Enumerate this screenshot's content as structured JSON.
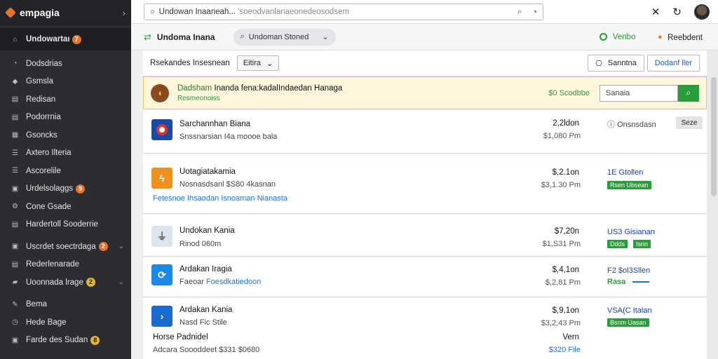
{
  "app": {
    "name": "empagia"
  },
  "sidebar": {
    "items": [
      {
        "label": "Undowartan",
        "icon": "home-icon",
        "badge": "7",
        "badge_color": "orange",
        "active": true
      },
      {
        "label": "Dodsdrias",
        "icon": "chart-icon"
      },
      {
        "label": "Gsmsla",
        "icon": "pin-icon"
      },
      {
        "label": "Redisan",
        "icon": "doc-icon"
      },
      {
        "label": "Podorrnia",
        "icon": "doc-icon"
      },
      {
        "label": "Gsoncks",
        "icon": "grid-icon"
      },
      {
        "label": "Axtero Ilteria",
        "icon": "list-icon"
      },
      {
        "label": "Ascorelile",
        "icon": "list-icon"
      },
      {
        "label": "Urdelsolaggs",
        "icon": "box-icon",
        "badge": "9",
        "badge_color": "orange"
      },
      {
        "label": "Cone Gsade",
        "icon": "gear-icon"
      },
      {
        "label": "Hardertoll Sooderrie",
        "icon": "doc-icon"
      },
      {
        "label": "Uscrdet soectrdaga",
        "icon": "box-icon",
        "badge": "2",
        "badge_color": "orange",
        "caret": true
      },
      {
        "label": "Rederlenarade",
        "icon": "doc-icon"
      },
      {
        "label": "Uoonnada lrage",
        "icon": "folder-icon",
        "badge": "2",
        "badge_color": "yellow",
        "caret": true
      },
      {
        "label": "Bema",
        "icon": "tool-icon"
      },
      {
        "label": "Hede Bage",
        "icon": "clock-icon"
      },
      {
        "label": "Farde des Sudan",
        "icon": "box-icon",
        "badge": "8",
        "badge_color": "yellow"
      }
    ]
  },
  "topbar": {
    "url_main": "Undowan Inaaneah...",
    "url_dim": "'soeodvanlanaeonedeosodsem"
  },
  "subbar": {
    "title": "Undoma Inana",
    "search_label": "Undoman Stoned",
    "right_link": "Venbo",
    "right_action": "Reebdent"
  },
  "filter": {
    "label": "Rsekandes Insesnean",
    "select_value": "Eitira",
    "btn_1": "Sanntna",
    "btn_2": "Dodanf ller"
  },
  "highlight": {
    "title_bold": "Dadsham",
    "title_rest": "Inanda fena:kadalIndaedan Hanaga",
    "subtitle": "Resmeonoiss",
    "price": "$0 Scodbbe",
    "search_placeholder": "Sanaia"
  },
  "rows": [
    {
      "name": "Sarchannhan Biana",
      "sub": "Snssnarsian I4a moooe bala",
      "price": "2,2ldon",
      "perf": "$1,080 Pm",
      "opts": "Onsnsdasn",
      "btn": "Seze",
      "logo_color": "#1a4aa8",
      "logo_icon": "circle-icon"
    },
    {
      "name": "Uotagiatakamia",
      "sub": "Nosnasdsanl $S80 4kasnan",
      "price": "$,2.1on",
      "perf": "$3,1.30 Pm",
      "status": "1E Gtollen",
      "tag": "Rsen Ubsean",
      "link": "Fetesnoe Ihsaodan Isnoaman Nianasta",
      "logo_color": "#f0901e",
      "logo_icon": "bolt-icon"
    },
    {
      "name": "Undokan Kania",
      "sub": "Rinod 060m",
      "price": "$7,20n",
      "perf": "$1,S31 Pm",
      "status": "US3 Gisianan",
      "tag": "Ddds",
      "tag2": "Isnn",
      "logo_color": "#dde4ee",
      "logo_icon": "plug-icon"
    },
    {
      "name": "Ardakan Iragia",
      "sub_plain": "Faeoar",
      "sub_link": "Foesdkatiedoon",
      "price": "$,4,1on",
      "perf": "$,2,81 Pm",
      "status": "F2 $ol3Sllen",
      "green": "Rasa",
      "logo_color": "#1a8ae8",
      "logo_icon": "app-icon"
    },
    {
      "name": "Ardakan Kania",
      "sub": "Nasd Fic Stile",
      "price": "$,9,1on",
      "perf": "$3,2,43 Pm",
      "status": "VSA(C Italan",
      "tag": "Bsnm Uasan",
      "logo_color": "#1a6ad0",
      "logo_icon": "arrow-icon"
    },
    {
      "name": "Horse Padnidel",
      "sub": "Adcara Soooddeet $331 $0680",
      "price": "Vern",
      "perf": "$320 File"
    }
  ]
}
